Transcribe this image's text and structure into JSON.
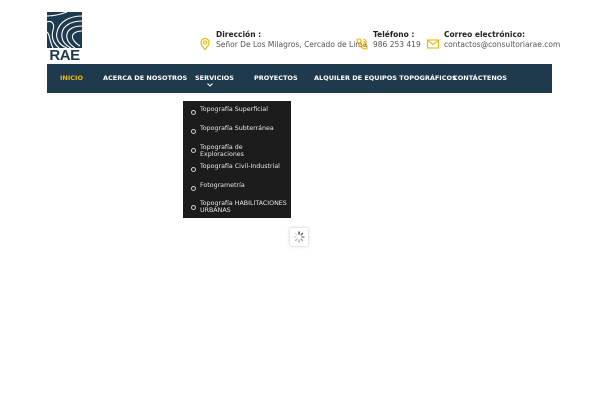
{
  "brand": {
    "logo_text": "RAE",
    "logo_color": "#1e3a50"
  },
  "contacts": {
    "address": {
      "icon": "map-pin-icon",
      "label": "Dirección :",
      "value": "Señor De Los Milagros, Cercado de Lima"
    },
    "phone": {
      "icon": "phone-icon",
      "label": "Teléfono :",
      "value": "986 253 419"
    },
    "email": {
      "icon": "envelope-icon",
      "label": "Correo electrónico:",
      "value": "contactos@consultoriarae.com"
    },
    "accent_color": "#f2b705"
  },
  "nav": {
    "background": "#1f3a4d",
    "active_color": "#f2b705",
    "items": [
      {
        "label": "INICIO",
        "active": true
      },
      {
        "label": "ACERCA DE NOSOTROS",
        "active": false
      },
      {
        "label": "SERVICIOS",
        "active": false,
        "has_submenu": true
      },
      {
        "label": "PROYECTOS",
        "active": false
      },
      {
        "label": "ALQUILER DE EQUIPOS TOPOGRÁFICOS",
        "active": false
      },
      {
        "label": "CONTÁCTENOS",
        "active": false
      }
    ]
  },
  "services_menu": {
    "background": "#1c1c1c",
    "items": [
      {
        "label": "Topografía Superficial"
      },
      {
        "label": "Topografía Subterránea"
      },
      {
        "label": "Topografía de Exploraciones"
      },
      {
        "label": "Topografía Civil-Industrial"
      },
      {
        "label": "Fotogrametría"
      },
      {
        "label": "Topografía HABILITACIONES URBANAS"
      }
    ]
  },
  "loader": {
    "icon": "spinner-icon"
  }
}
